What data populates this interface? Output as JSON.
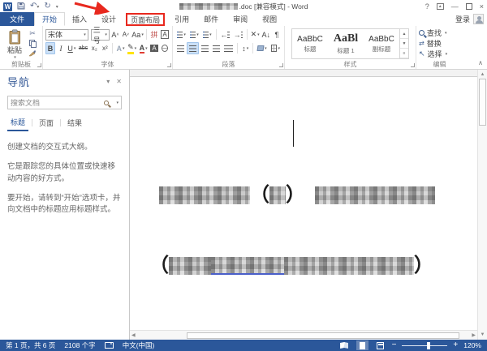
{
  "titlebar": {
    "doc_suffix": ".doc [兼容模式] - Word",
    "help": "?"
  },
  "tabs": {
    "file": "文件",
    "home": "开始",
    "insert": "插入",
    "design": "设计",
    "layout": "页面布局",
    "references": "引用",
    "mailings": "邮件",
    "review": "审阅",
    "view": "视图",
    "signin": "登录"
  },
  "ribbon": {
    "paste": "粘贴",
    "clipboard_label": "剪贴板",
    "font_family": "宋体",
    "font_size": "三号",
    "bold": "B",
    "italic": "I",
    "underline": "U",
    "strike": "abc",
    "sub": "x₂",
    "sup": "x²",
    "font_label": "字体",
    "paragraph_label": "段落",
    "styles_label": "样式",
    "style1_preview": "AaBbC",
    "style1_name": "标题",
    "style2_preview": "AaBl",
    "style2_name": "标题 1",
    "style3_preview": "AaBbC",
    "style3_name": "副标题",
    "find": "查找",
    "replace": "替换",
    "select": "选择",
    "editing_label": "编辑"
  },
  "nav": {
    "title": "导航",
    "search_placeholder": "搜索文档",
    "tab_headings": "标题",
    "tab_pages": "页面",
    "tab_results": "结果",
    "p1": "创建文档的交互式大纲。",
    "p2": "它是跟踪您的具体位置或快速移动内容的好方式。",
    "p3": "要开始，请转到“开始”选项卡，并向文档中的标题应用标题样式。"
  },
  "document": {
    "open_paren": "（",
    "close_paren": "）"
  },
  "statusbar": {
    "page_info": "第 1 页，共 6 页",
    "word_count": "2108 个字",
    "language": "中文(中国)",
    "zoom_level": "120%"
  },
  "colors": {
    "accent": "#2b579a",
    "annotation_red": "#e8281e",
    "highlight_yellow": "#ffe400",
    "font_color_red": "#e03c32",
    "hyperlink_blue": "#4a5fc9"
  }
}
